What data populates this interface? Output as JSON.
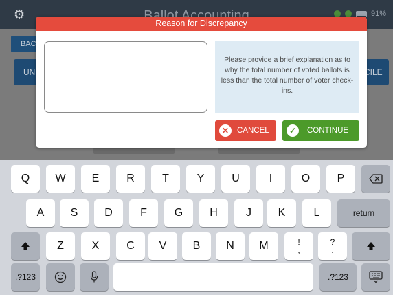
{
  "app": {
    "title": "Ballot Accounting",
    "battery": "91%",
    "back_label": "BAC",
    "left_button_label": "UN",
    "right_button_label": "CILE"
  },
  "modal": {
    "title": "Reason for Discrepancy",
    "textarea_value": "",
    "info_text": "Please provide a brief explanation as to why the total number of voted ballots is less than the total number of voter check-ins.",
    "cancel_label": "CANCEL",
    "continue_label": "CONTINUE"
  },
  "keyboard": {
    "row1": [
      "Q",
      "W",
      "E",
      "R",
      "T",
      "Y",
      "U",
      "I",
      "O",
      "P"
    ],
    "row2": [
      "A",
      "S",
      "D",
      "F",
      "G",
      "H",
      "J",
      "K",
      "L"
    ],
    "return_label": "return",
    "row3": [
      "Z",
      "X",
      "C",
      "V",
      "B",
      "N",
      "M"
    ],
    "punct1_top": "!",
    "punct1_bottom": ",",
    "punct2_top": "?",
    "punct2_bottom": ".",
    "numbers_label": ".?123"
  },
  "icons": {
    "settings": "gear-icon",
    "backspace": "backspace-icon",
    "shift": "shift-icon",
    "emoji": "emoji-icon",
    "mic": "microphone-icon",
    "hide_keyboard": "keyboard-hide-icon",
    "cancel": "x-circle-icon",
    "continue": "checkmark-circle-icon"
  },
  "colors": {
    "modal_header": "#e54b3d",
    "cancel": "#e04a3c",
    "continue": "#4c9a2a",
    "info_box": "#deebf4"
  }
}
